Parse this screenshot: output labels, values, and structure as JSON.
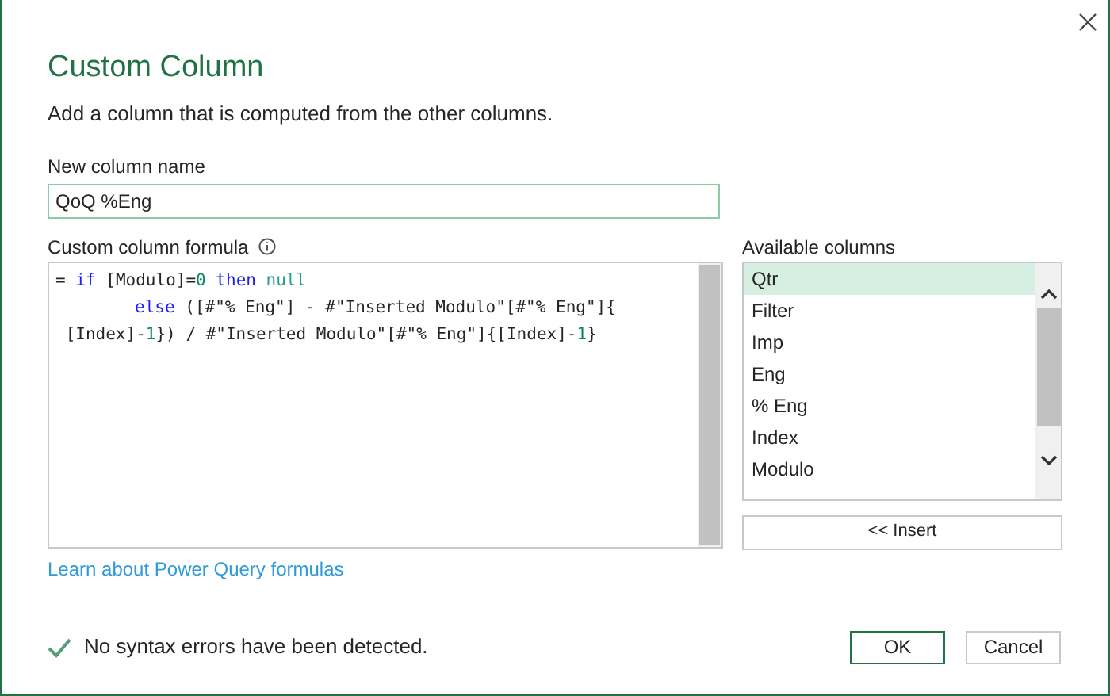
{
  "dialog": {
    "title": "Custom Column",
    "description": "Add a column that is computed from the other columns."
  },
  "name_field": {
    "label": "New column name",
    "value": "QoQ %Eng"
  },
  "formula": {
    "label": "Custom column formula",
    "lines": [
      {
        "indented": false,
        "tokens": [
          {
            "kind": "plain",
            "text": "= "
          },
          {
            "kind": "keyword",
            "text": "if"
          },
          {
            "kind": "plain",
            "text": " [Modulo]="
          },
          {
            "kind": "number",
            "text": "0"
          },
          {
            "kind": "keyword",
            "text": " then"
          },
          {
            "kind": "literal",
            "text": " null"
          }
        ]
      },
      {
        "indented": true,
        "tokens": [
          {
            "kind": "keyword",
            "text": "else"
          },
          {
            "kind": "plain",
            "text": " ([#\"% Eng\"] - #\"Inserted Modulo\"[#\"% Eng\"]{"
          }
        ]
      },
      {
        "indented": false,
        "tokens": [
          {
            "kind": "plain",
            "text": " [Index]-"
          },
          {
            "kind": "number",
            "text": "1"
          },
          {
            "kind": "plain",
            "text": "}) / #\"Inserted Modulo\"[#\"% Eng\"]{[Index]-"
          },
          {
            "kind": "number",
            "text": "1"
          },
          {
            "kind": "plain",
            "text": "}"
          }
        ]
      }
    ]
  },
  "available_columns": {
    "label": "Available columns",
    "items": [
      {
        "label": "Qtr",
        "selected": true
      },
      {
        "label": "Filter",
        "selected": false
      },
      {
        "label": "Imp",
        "selected": false
      },
      {
        "label": "Eng",
        "selected": false
      },
      {
        "label": "% Eng",
        "selected": false
      },
      {
        "label": "Index",
        "selected": false
      },
      {
        "label": "Modulo",
        "selected": false
      }
    ],
    "insert_button": "<< Insert"
  },
  "help_link": "Learn about Power Query formulas",
  "status": "No syntax errors have been detected.",
  "buttons": [
    "OK",
    "Cancel"
  ]
}
